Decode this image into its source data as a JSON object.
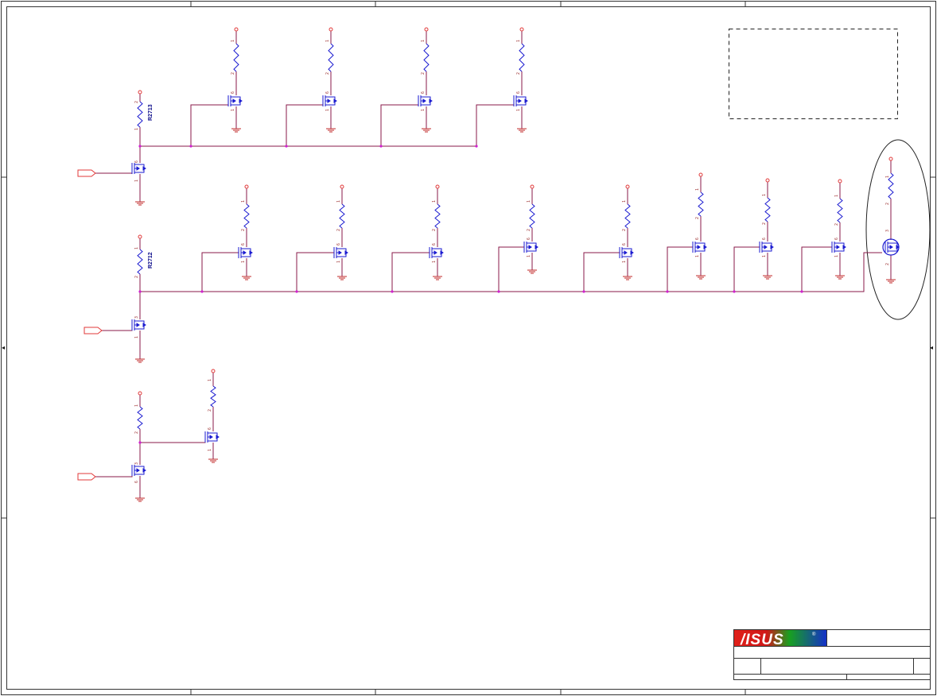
{
  "sheet": {
    "brand": {
      "logo_text": "/ISUS",
      "registered_mark": "®",
      "colors": [
        "#e0201a",
        "#16a020",
        "#1430c8"
      ]
    },
    "reference_designators": [
      "R2713",
      "R2712"
    ],
    "pin_numbers": {
      "one": "1",
      "two": "2",
      "three": "3",
      "six": "6"
    },
    "zone_markers": {
      "left_arrow": "◂",
      "right_arrow": "◂"
    },
    "colors": {
      "wire": "#8a1a4a",
      "component": "#1a1ad0",
      "port": "#e23a3a",
      "power_pin": "#e23a3a",
      "ground": "#c0282a",
      "junction": "#d020d0",
      "border": "#333333",
      "background": "#ffffff"
    },
    "title_block": {
      "title": "",
      "project": "",
      "size": "",
      "document_number": "",
      "revision": "",
      "date": "",
      "sheet": ""
    }
  }
}
